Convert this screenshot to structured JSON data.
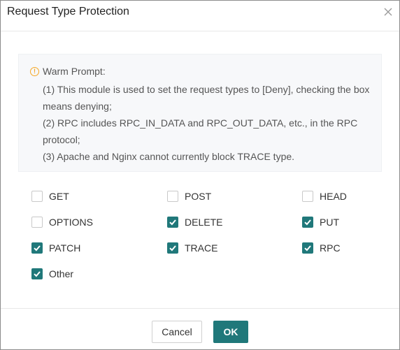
{
  "dialog": {
    "title": "Request Type Protection",
    "close_icon": "close-icon"
  },
  "prompt": {
    "heading": "Warm Prompt:",
    "icon": "warning-circle-icon",
    "lines": [
      "(1) This module is used to set the request types to [Deny], checking the box means denying;",
      "(2) RPC includes RPC_IN_DATA and RPC_OUT_DATA, etc., in the RPC protocol;",
      "(3) Apache and Nginx cannot currently block TRACE type."
    ]
  },
  "options": [
    {
      "label": "GET",
      "checked": false
    },
    {
      "label": "POST",
      "checked": false
    },
    {
      "label": "HEAD",
      "checked": false
    },
    {
      "label": "OPTIONS",
      "checked": false
    },
    {
      "label": "DELETE",
      "checked": true
    },
    {
      "label": "PUT",
      "checked": true
    },
    {
      "label": "PATCH",
      "checked": true
    },
    {
      "label": "TRACE",
      "checked": true
    },
    {
      "label": "RPC",
      "checked": true
    },
    {
      "label": "Other",
      "checked": true
    }
  ],
  "footer": {
    "cancel_label": "Cancel",
    "ok_label": "OK"
  },
  "colors": {
    "accent": "#20787a",
    "warning": "#f5a623"
  }
}
